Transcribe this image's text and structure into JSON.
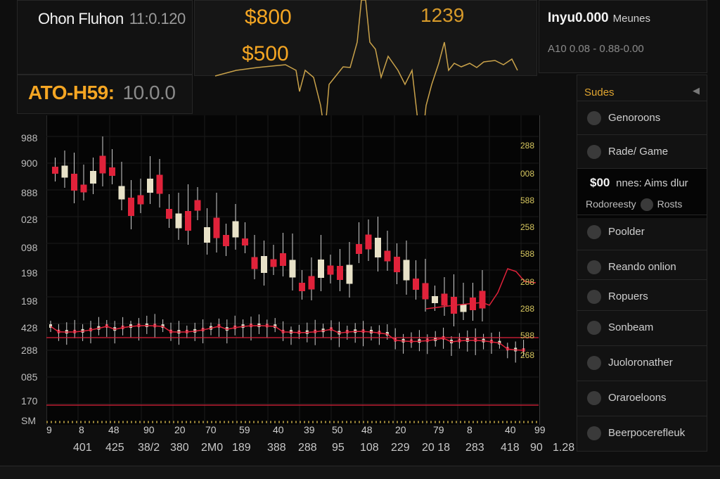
{
  "header": {
    "title": "Ohon Fluhon",
    "time": "11:0.120",
    "ticker": "ATO-H59:",
    "ticker_value": "10.0.0",
    "price_a": "$800",
    "price_b": "$500",
    "price_c": "1239"
  },
  "right_panel": {
    "title": "Inyu0.000",
    "title_sub": "Meunes",
    "sub": "A10 0.08 - 0.88-0.00"
  },
  "sidebar": {
    "title": "Sudes",
    "highlight": {
      "price": "$00",
      "price_sub": "nnes: Aims dlur",
      "left": "Rodoreesty",
      "right": "Rosts"
    },
    "items": [
      {
        "label": "Genoroons",
        "icon": "circle-icon"
      },
      {
        "label": "Rade/ Game",
        "icon": "circle-icon"
      },
      {
        "label": "Poolder",
        "icon": "circle-icon"
      },
      {
        "label": "Reando onlion",
        "icon": "circle-icon"
      },
      {
        "label": "Ropuers",
        "icon": "circle-icon"
      },
      {
        "label": "Sonbeam",
        "icon": "circle-icon"
      },
      {
        "label": "Juoloronather",
        "icon": "circle-icon"
      },
      {
        "label": "Oraroeloons",
        "icon": "circle-icon"
      },
      {
        "label": "Beerpocerefleuk",
        "icon": "circle-icon"
      }
    ]
  },
  "chart": {
    "left_axis": [
      "988",
      "900",
      "888",
      "028",
      "098",
      "198",
      "198",
      "428",
      "288",
      "085",
      "170"
    ],
    "left_axis_last": "SM",
    "right_axis": [
      "288",
      "008",
      "588",
      "258",
      "588",
      "288",
      "288",
      "588",
      "268"
    ],
    "x_top": [
      "9",
      "8",
      "48",
      "90",
      "20",
      "70",
      "59",
      "40",
      "39",
      "50",
      "48",
      "20",
      "79",
      "8",
      "40",
      "99"
    ],
    "x_bottom": [
      "401",
      "425",
      "38/2",
      "380",
      "2M0",
      "189",
      "388",
      "288",
      "95",
      "108",
      "229",
      "20 18",
      "283",
      "418",
      "90",
      "1.28"
    ],
    "colors": {
      "up": "#e8e2c8",
      "down": "#e0223a",
      "wick": "#cfcfcf",
      "accent": "#f5a623"
    }
  }
}
